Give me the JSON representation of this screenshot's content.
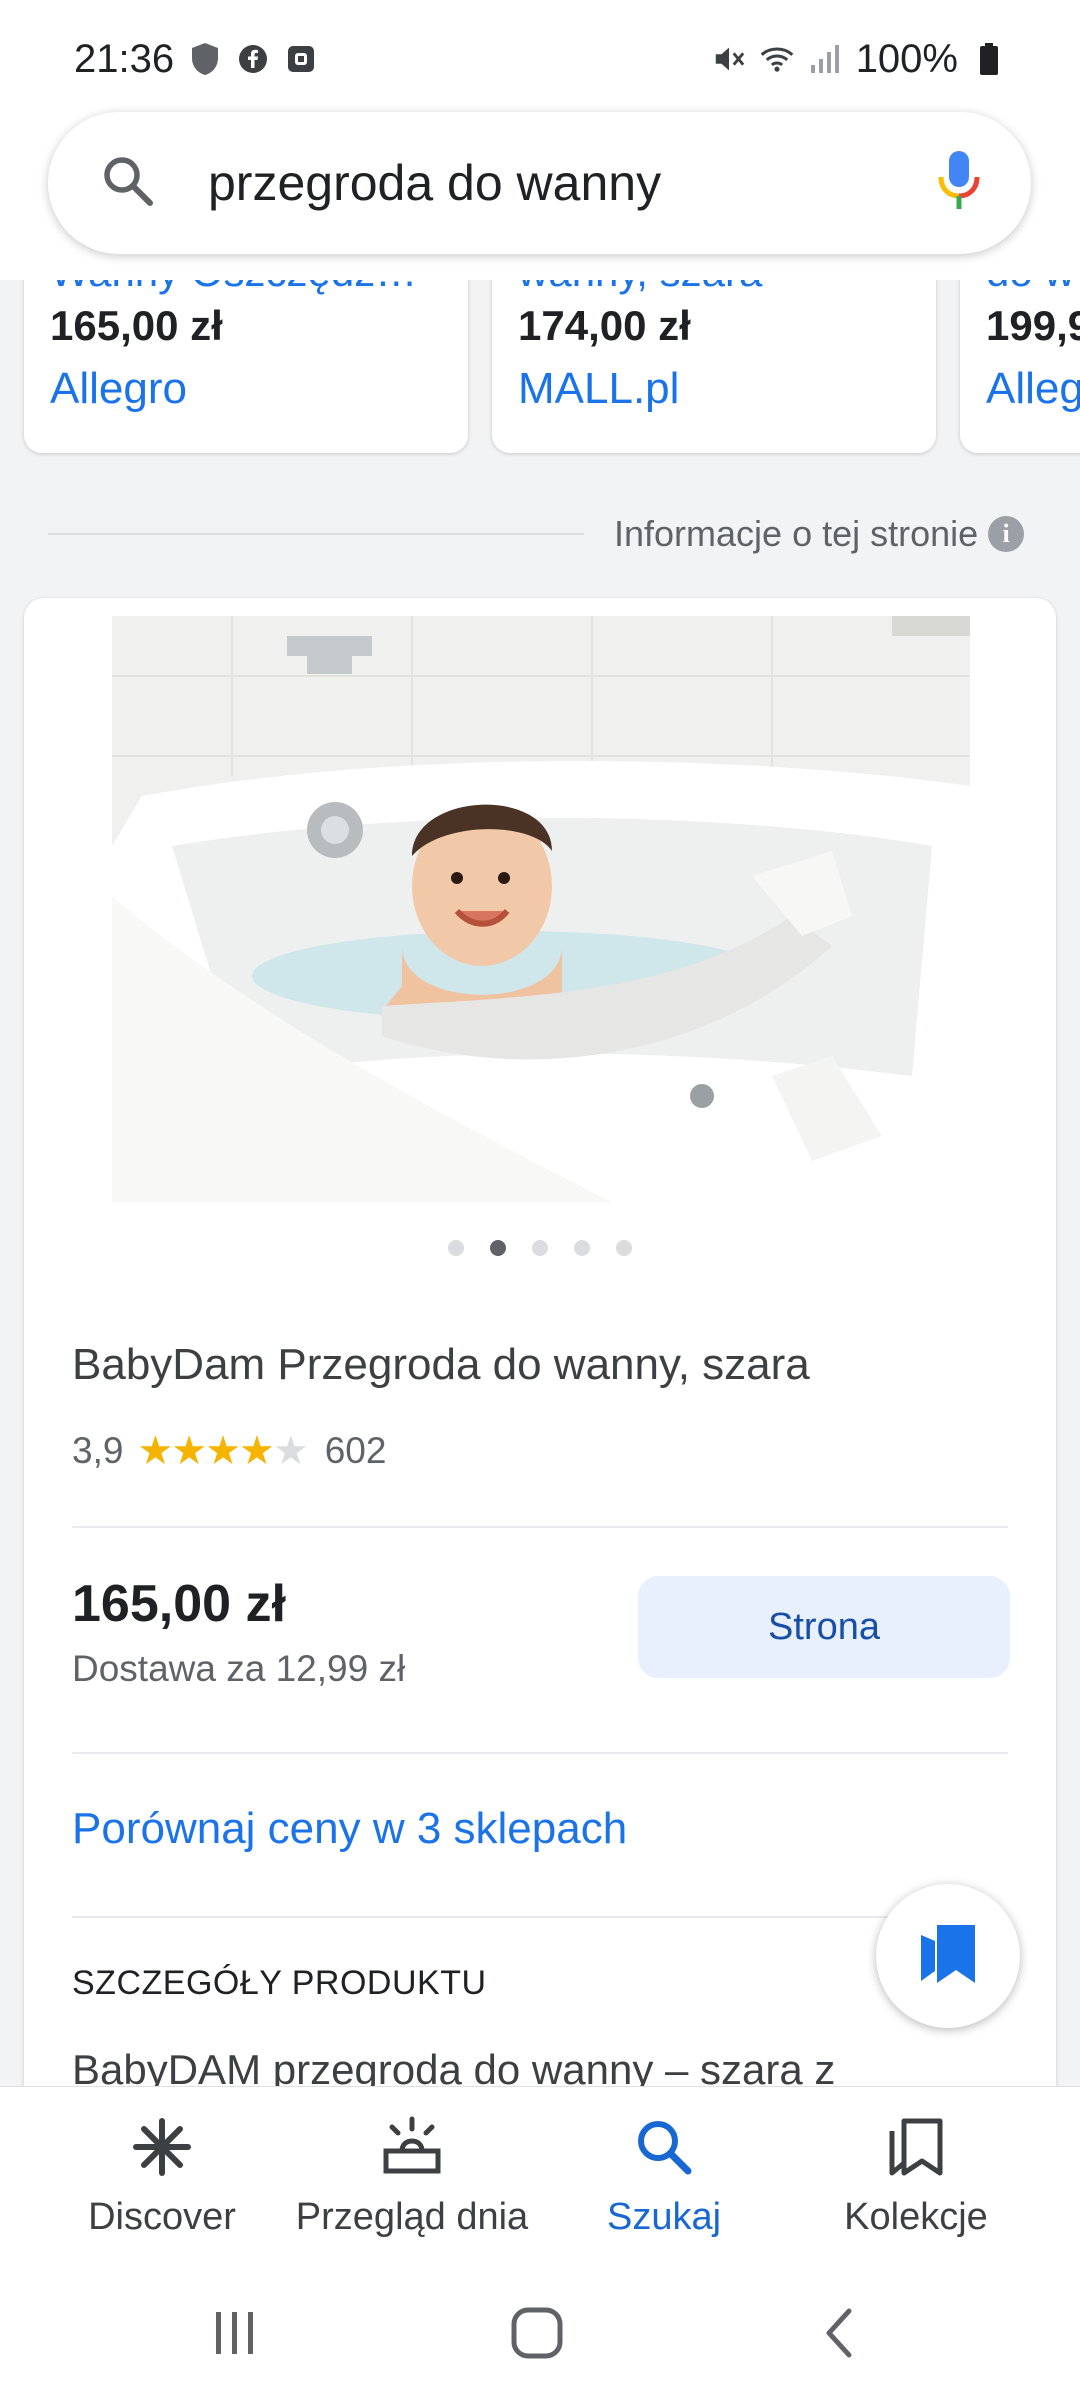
{
  "status": {
    "time": "21:36",
    "battery": "100%",
    "icons": [
      "shield-icon",
      "facebook-icon",
      "square-app-icon",
      "mute-icon",
      "wifi-icon",
      "signal-icon",
      "battery-icon"
    ]
  },
  "search": {
    "query": "przegroda do wanny",
    "icons": [
      "search-icon",
      "mic-icon"
    ]
  },
  "shopping_carousel": [
    {
      "cut_title": "Wanny Oszczędz…",
      "price": "165,00 zł",
      "store": "Allegro"
    },
    {
      "cut_title": "wanny, szara",
      "price": "174,00 zł",
      "store": "MALL.pl"
    },
    {
      "cut_title": "do w",
      "price": "199,9",
      "store": "Alleg"
    }
  ],
  "info": {
    "label": "Informacje o tej stronie",
    "icon": "info-icon"
  },
  "product": {
    "title": "BabyDam Przegroda do wanny, szara",
    "rating": "3,9",
    "rating_value": 3.9,
    "rating_max": 5,
    "review_count": "602",
    "image_count": 5,
    "active_image": 2,
    "price": "165,00 zł",
    "shipping": "Dostawa za 12,99 zł",
    "site_button": "Strona",
    "compare_link": "Porównaj ceny w 3 sklepach",
    "details_heading": "SZCZEGÓŁY PRODUKTU",
    "details_text": "BabyDAM przegroda do wanny – szara z"
  },
  "fab": {
    "icon": "collections-bookmark-icon"
  },
  "bottom_nav": [
    {
      "label": "Discover",
      "icon": "asterisk-icon",
      "active": false
    },
    {
      "label": "Przegląd dnia",
      "icon": "daily-sunrise-icon",
      "active": false
    },
    {
      "label": "Szukaj",
      "icon": "search-icon",
      "active": true
    },
    {
      "label": "Kolekcje",
      "icon": "bookmarks-icon",
      "active": false
    }
  ],
  "system_nav": [
    "recents-icon",
    "home-icon",
    "back-icon"
  ],
  "colors": {
    "link_blue": "#1a73e8",
    "active_nav": "#1967d2",
    "star": "#f4b400",
    "button_bg": "#e8f0fe",
    "page_bg": "#f1f3f4"
  }
}
